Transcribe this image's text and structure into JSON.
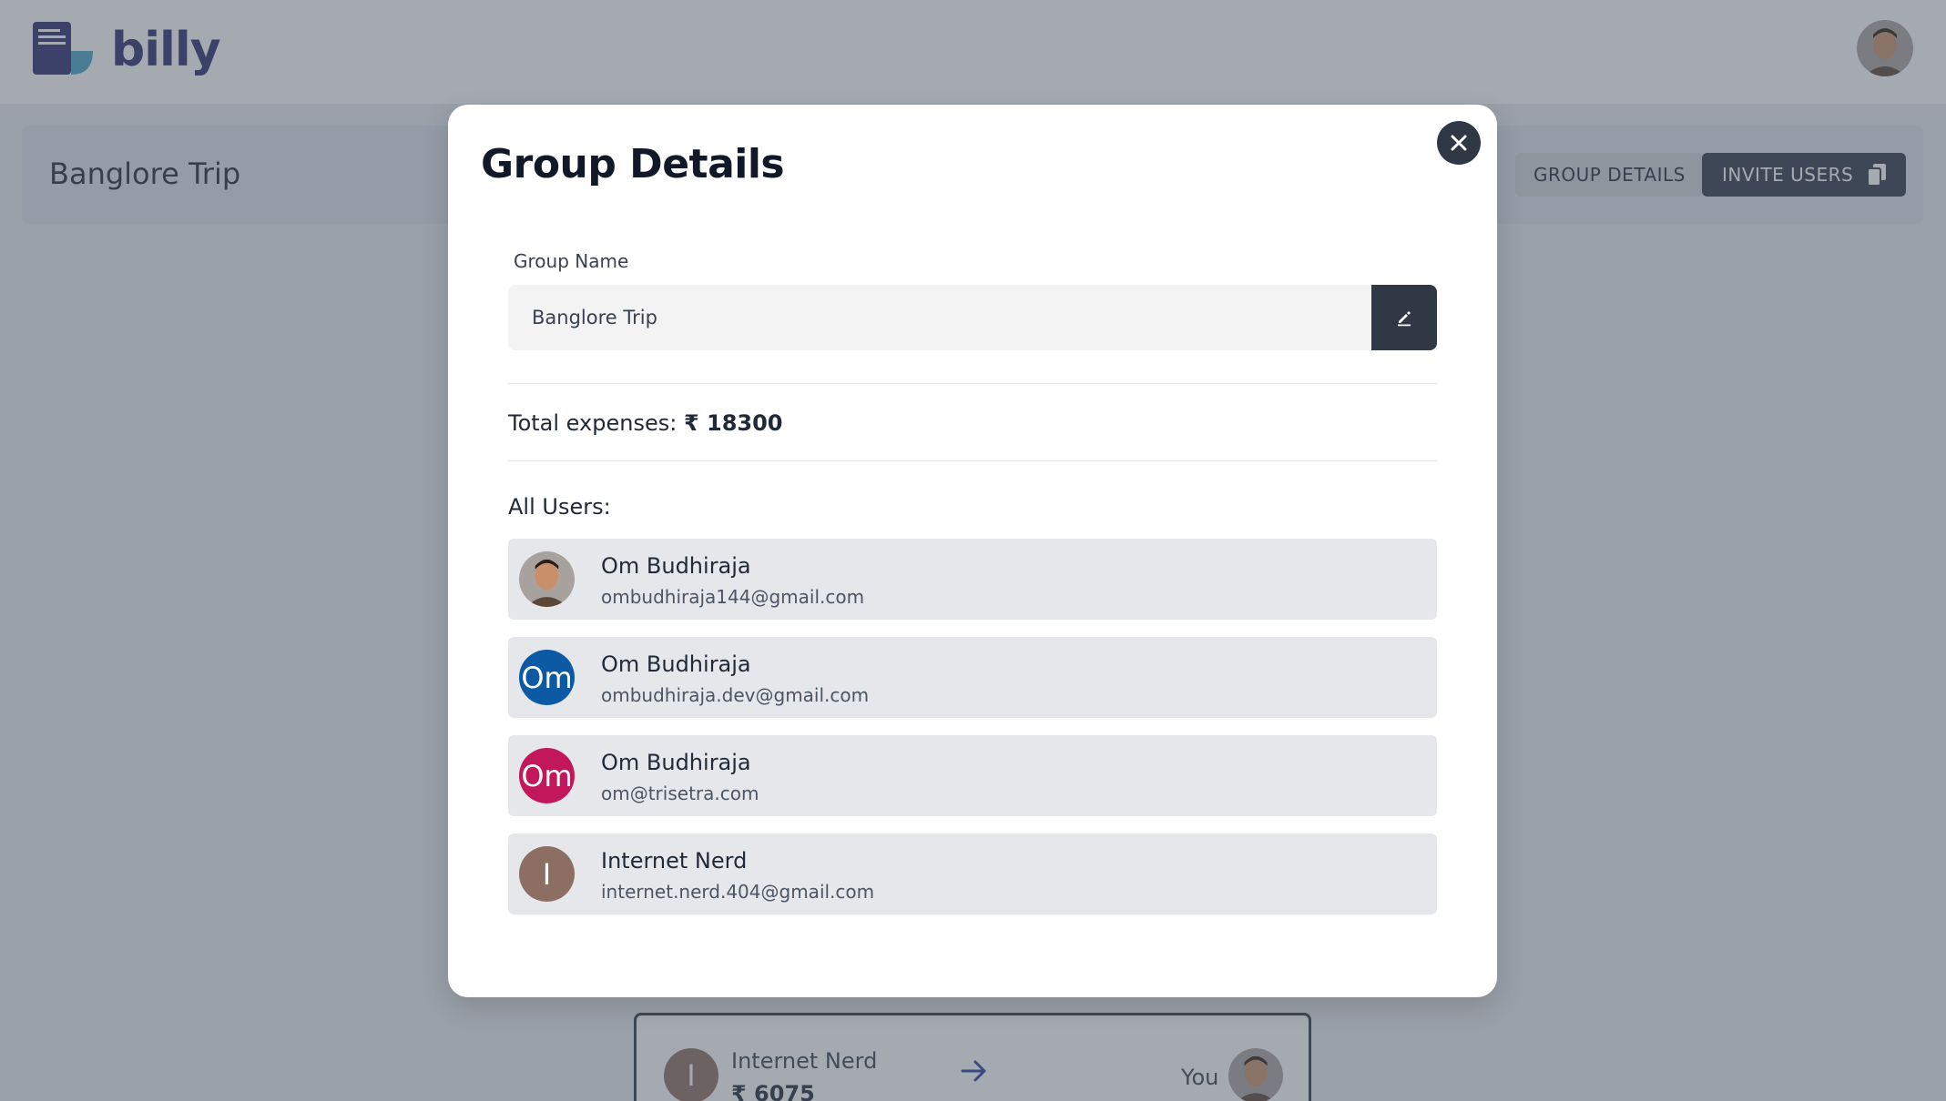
{
  "app": {
    "name": "billy"
  },
  "group_bar": {
    "title": "Banglore Trip",
    "group_details_label": "GROUP DETAILS",
    "invite_users_label": "INVITE USERS"
  },
  "settlement": {
    "from_initial": "I",
    "from_name": "Internet Nerd",
    "amount": "₹ 6075",
    "to_label": "You"
  },
  "modal": {
    "title": "Group Details",
    "group_name_label": "Group Name",
    "group_name_value": "Banglore Trip",
    "total_label": "Total expenses:",
    "total_value": "₹ 18300",
    "users_label": "All Users:",
    "users": [
      {
        "name": "Om Budhiraja",
        "email": "ombudhiraja144@gmail.com",
        "initials": "",
        "avatar_type": "photo",
        "color": "#9ca3af"
      },
      {
        "name": "Om Budhiraja",
        "email": "ombudhiraja.dev@gmail.com",
        "initials": "Om",
        "avatar_type": "initials",
        "color": "#0b5aa3"
      },
      {
        "name": "Om Budhiraja",
        "email": "om@trisetra.com",
        "initials": "Om",
        "avatar_type": "initials",
        "color": "#c2185b"
      },
      {
        "name": "Internet Nerd",
        "email": "internet.nerd.404@gmail.com",
        "initials": "I",
        "avatar_type": "initials",
        "color": "#8d6e63"
      }
    ]
  }
}
